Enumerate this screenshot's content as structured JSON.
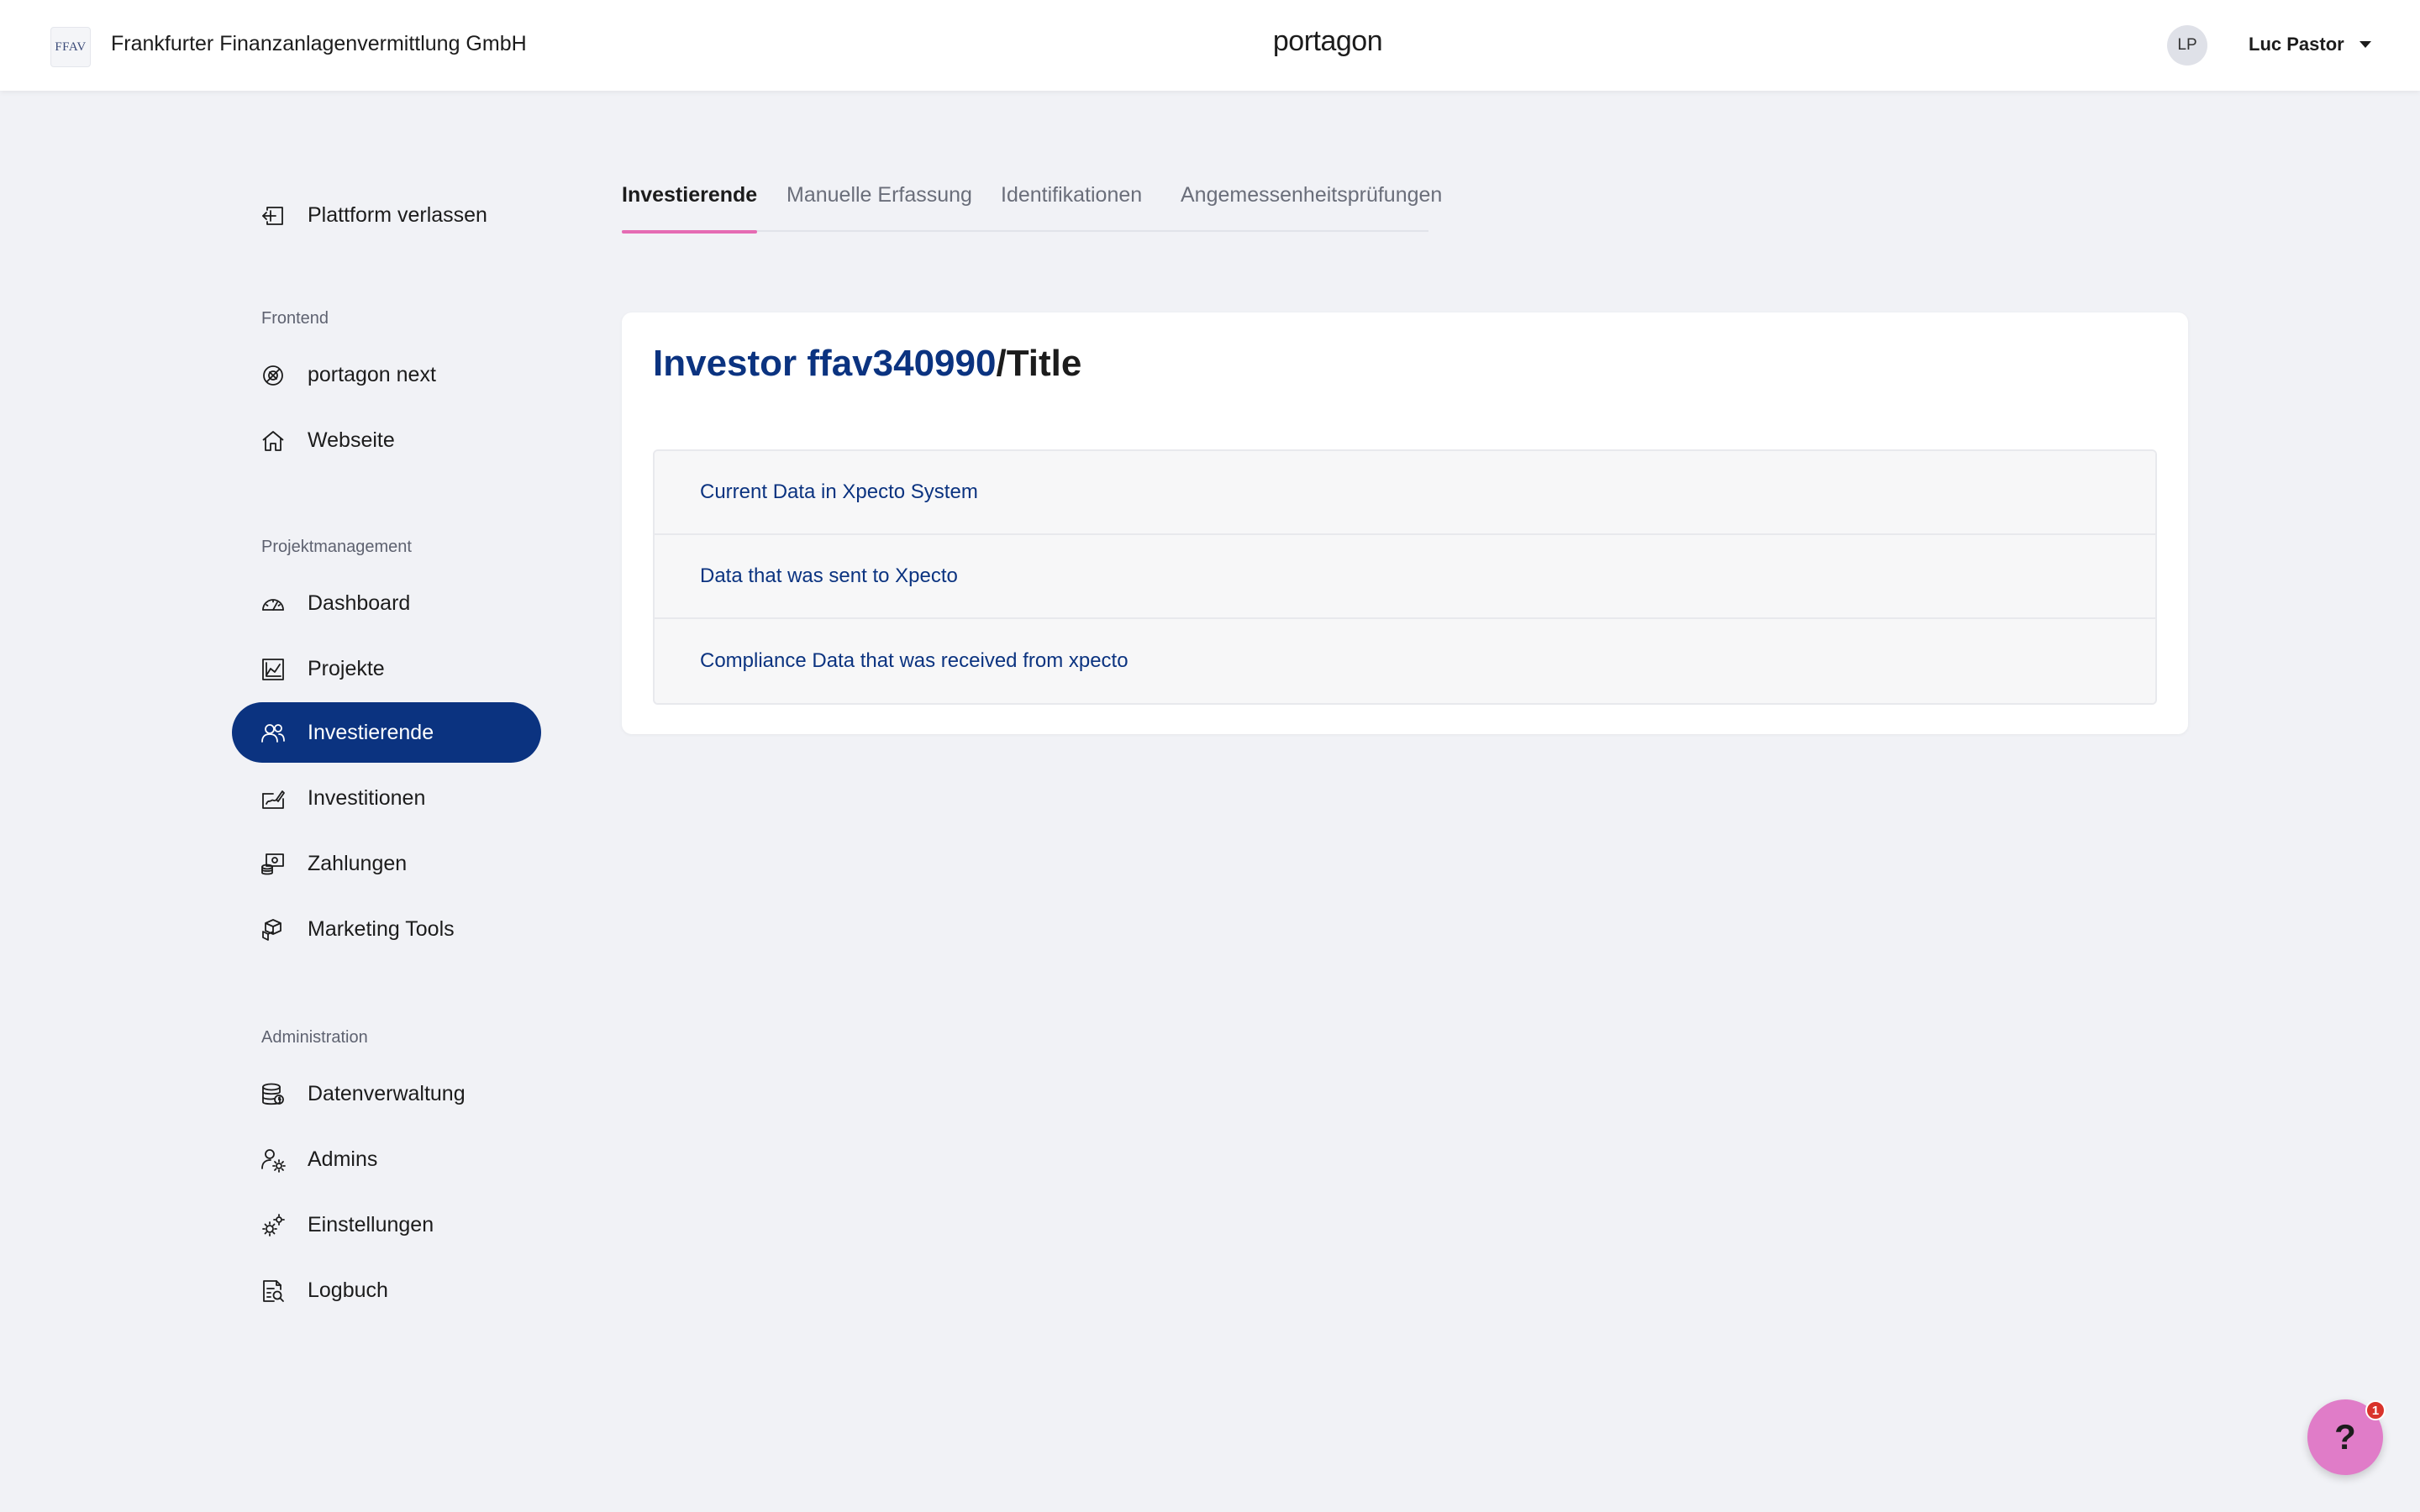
{
  "header": {
    "org_logo_text": "FFAV",
    "org_name": "Frankfurter Finanzanlagenvermittlung GmbH",
    "brand": "portagon",
    "user_initials": "LP",
    "user_name": "Luc Pastor"
  },
  "sidebar": {
    "exit_label": "Plattform verlassen",
    "sections": [
      {
        "title": "Frontend",
        "items": [
          {
            "label": "portagon next",
            "icon": "portagon-next-icon"
          },
          {
            "label": "Webseite",
            "icon": "home-icon"
          }
        ]
      },
      {
        "title": "Projektmanagement",
        "items": [
          {
            "label": "Dashboard",
            "icon": "speedometer-icon"
          },
          {
            "label": "Projekte",
            "icon": "chart-icon"
          },
          {
            "label": "Investierende",
            "icon": "users-icon",
            "active": true
          },
          {
            "label": "Investitionen",
            "icon": "signature-icon"
          },
          {
            "label": "Zahlungen",
            "icon": "payments-icon"
          },
          {
            "label": "Marketing Tools",
            "icon": "cubes-icon"
          }
        ]
      },
      {
        "title": "Administration",
        "items": [
          {
            "label": "Datenverwaltung",
            "icon": "database-icon"
          },
          {
            "label": "Admins",
            "icon": "admin-user-icon"
          },
          {
            "label": "Einstellungen",
            "icon": "settings-gears-icon"
          },
          {
            "label": "Logbuch",
            "icon": "logbook-icon"
          }
        ]
      }
    ]
  },
  "tabs": [
    {
      "label": "Investierende",
      "active": true
    },
    {
      "label": "Manuelle Erfassung"
    },
    {
      "label": "Identifikationen"
    },
    {
      "label": "Angemessenheitsprüfungen"
    }
  ],
  "card": {
    "title_id": "Investor ffav340990",
    "title_rest": "/Title",
    "rows": [
      "Current Data in Xpecto System",
      "Data that was sent to Xpecto",
      "Compliance Data that was received from xpecto"
    ]
  },
  "help": {
    "label": "?",
    "badge": "1"
  },
  "colors": {
    "primary": "#0b3380",
    "accent": "#e56bb3",
    "background": "#f1f2f6",
    "help_button": "#e07cc8",
    "badge": "#d9332b"
  }
}
